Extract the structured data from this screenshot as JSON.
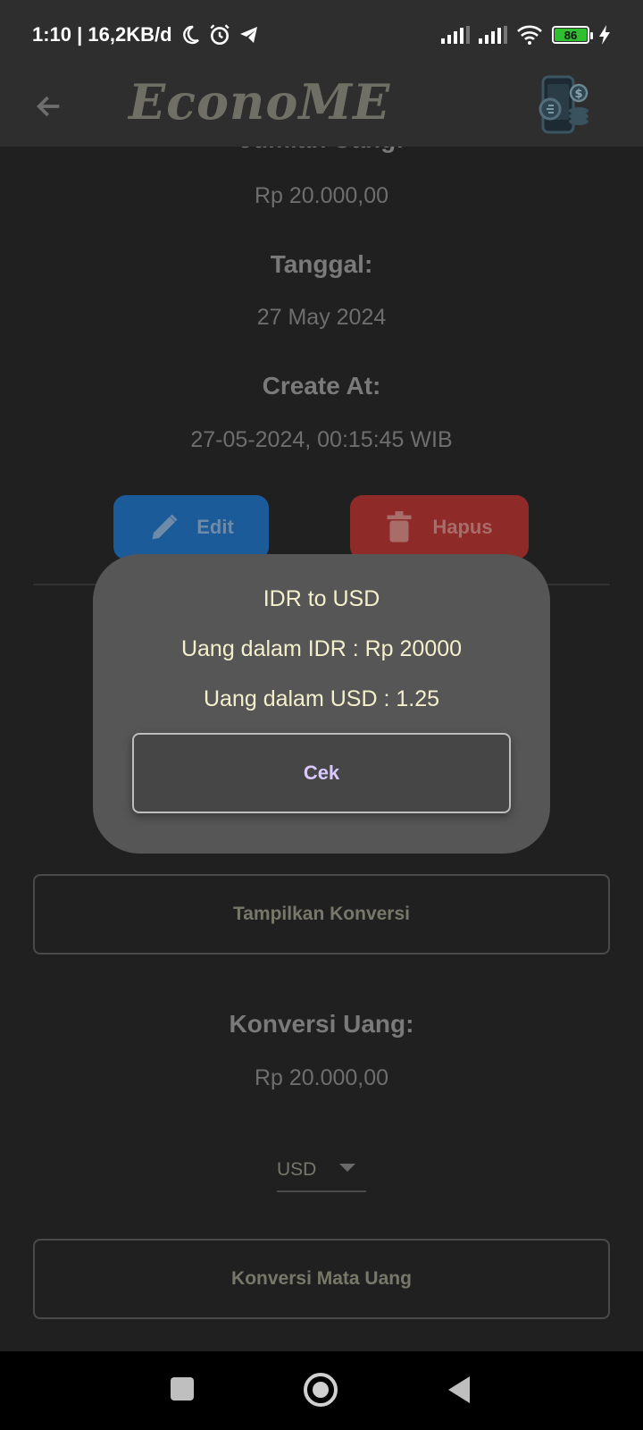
{
  "status_bar": {
    "time_info": "1:10 | 16,2KB/d",
    "battery": "86"
  },
  "app_bar": {
    "title": "EconoME"
  },
  "details": {
    "amount_label": "Jumlah Uang:",
    "amount_value": "Rp 20.000,00",
    "date_label": "Tanggal:",
    "date_value": "27 May 2024",
    "created_label": "Create At:",
    "created_value": "27-05-2024, 00:15:45 WIB"
  },
  "actions": {
    "edit_label": "Edit",
    "delete_label": "Hapus"
  },
  "dialog": {
    "title": "IDR to USD",
    "idr_text": "Uang dalam IDR : Rp 20000",
    "usd_text": "Uang dalam USD : 1.25",
    "button_label": "Cek"
  },
  "show_conversion_button": "Tampilkan Konversi",
  "conversion": {
    "label": "Konversi Uang:",
    "value": "Rp 20.000,00",
    "currency_selected": "USD",
    "button_label": "Konversi Mata Uang"
  },
  "icons": {
    "back": "arrow-left-icon",
    "edit": "pencil-icon",
    "delete": "trash-icon",
    "logo": "phone-coins-logo"
  },
  "colors": {
    "edit_button": "#1c5b99",
    "delete_button": "#8e2a28",
    "dialog_text": "#f4f0cc",
    "dialog_button_text": "#d8c8ff"
  }
}
